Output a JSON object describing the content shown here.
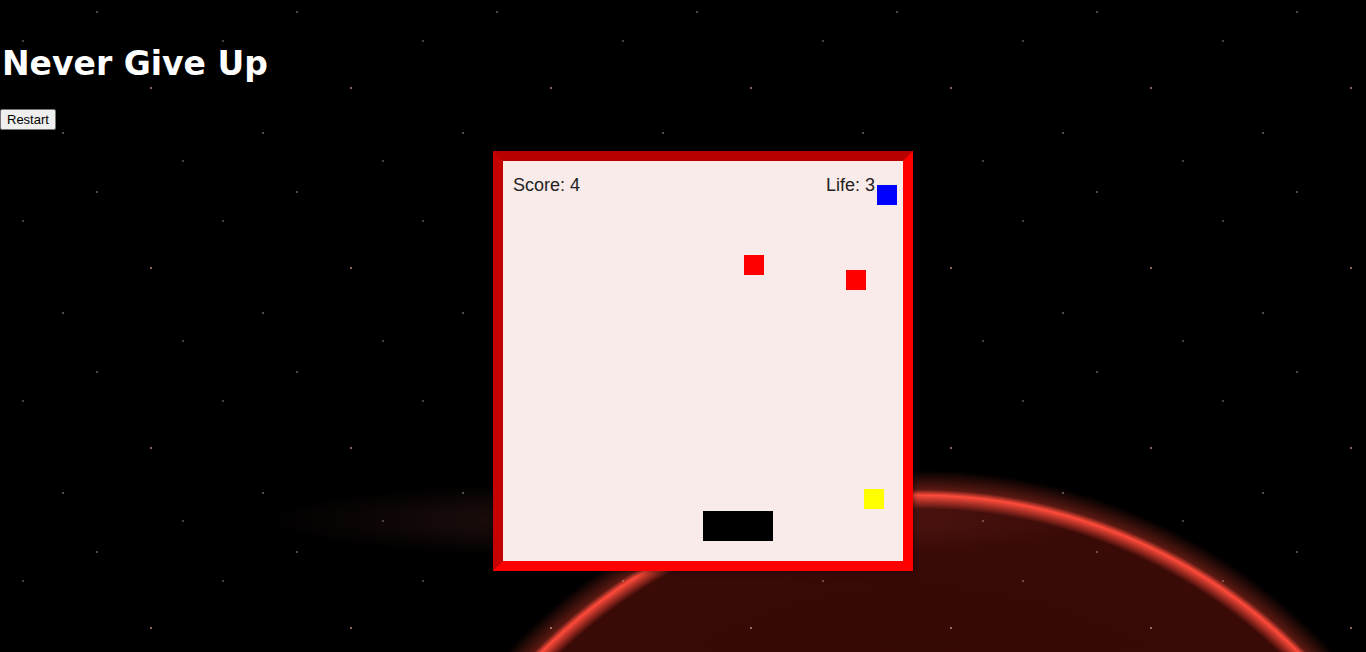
{
  "page": {
    "title": "Never Give Up",
    "restart_button": "Restart"
  },
  "hud": {
    "score": "Score: 4",
    "life": "Life: 3"
  },
  "blocks": [
    {
      "color": "#0000ff"
    },
    {
      "color": "#ff0000"
    },
    {
      "color": "#ff0000"
    },
    {
      "color": "#ffff00"
    }
  ],
  "paddle": {
    "color": "#000000"
  }
}
